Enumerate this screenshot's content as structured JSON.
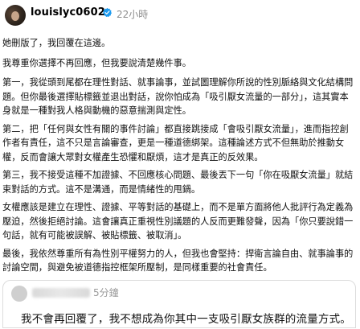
{
  "header": {
    "username": "louislyc0602",
    "timestamp": "22小時",
    "verified_color": "#1d9bf0"
  },
  "post": {
    "paragraphs": [
      "她刪版了，我回覆在這邊。",
      "我尊重你選擇不再回應，但我要說清楚幾件事。",
      "第一，我從頭到尾都在理性對話、就事論事，並試圖理解你所說的性別脈絡與文化結構問題。但你最後選擇貼標籤並退出對話，說你怕成為「吸引厭女流量的一部分」，這其實本身就是一種對我人格與動機的惡意揣測與定性。",
      "第二，把「任何與女性有關的事件討論」都直接跳接成「會吸引厭女流量」，進而指控創作者有責任，這不只是言論審查，更是一種道德綁架。這種論述方式不但無助於推動女權，反而會讓大眾對女權產生恐懼和厭煩，這才是真正的反效果。",
      "第三，我不接受這種不加證據、不回應核心問題、最後丟下一句「你在吸厭女流量」就結束對話的方式。這不是溝通，而是情緒性的甩鍋。",
      "女權應該是建立在理性、證據、平等對話的基礎上，而不是單方面將他人批評行為定義為壓迫，然後拒絕討論。這會讓真正重視性別議題的人反而更難發聲，因為「你只要說錯一句話，就有可能被誤解、被貼標籤、被取消」。",
      "最後，我依然尊重所有為性別平權努力的人，但我也會堅持：捍衛言論自由、就事論事的討論空間，與避免被道德指控框架所壓制，是同樣重要的社會責任。"
    ]
  },
  "reply": {
    "time": "5分鐘",
    "text": "我不會再回覆了，我不想成為你其中一支吸引厭女族群的流量方式。"
  }
}
